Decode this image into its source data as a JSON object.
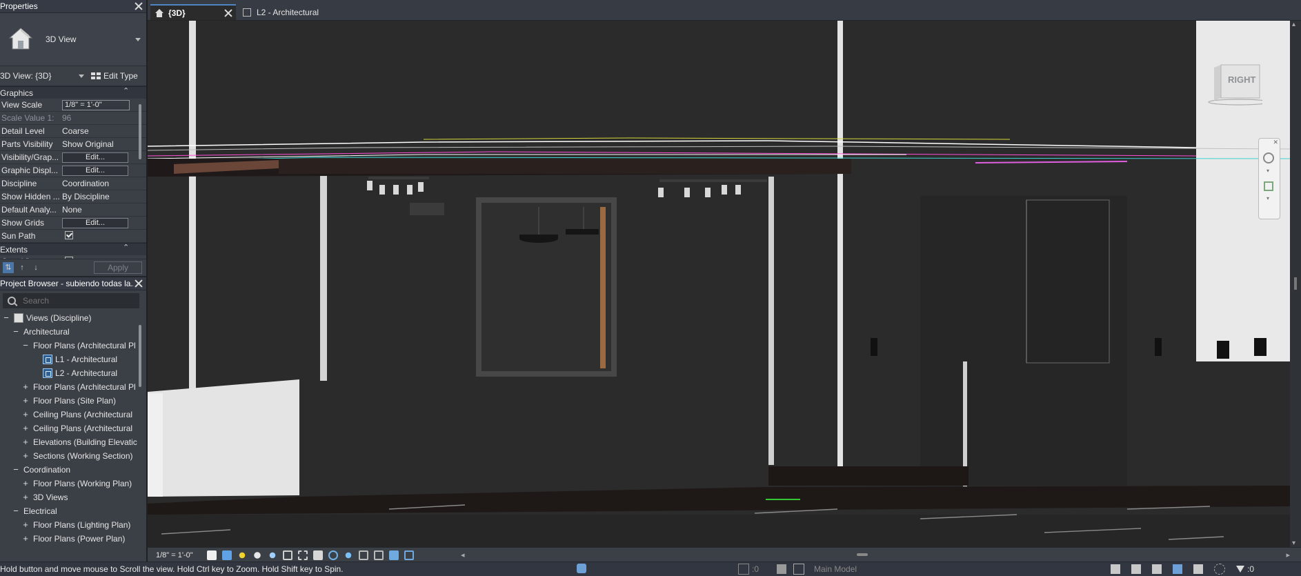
{
  "properties": {
    "title": "Properties",
    "type_name": "3D View",
    "view_selector": "3D View: {3D}",
    "edit_type": "Edit Type",
    "group_graphics": "Graphics",
    "rows": [
      {
        "key": "View Scale",
        "value": "1/8\" = 1'-0\"",
        "kind": "input"
      },
      {
        "key": "Scale Value    1:",
        "value": "96",
        "kind": "dim"
      },
      {
        "key": "Detail Level",
        "value": "Coarse",
        "kind": "text"
      },
      {
        "key": "Parts Visibility",
        "value": "Show Original",
        "kind": "text"
      },
      {
        "key": "Visibility/Grap...",
        "value": "Edit...",
        "kind": "button"
      },
      {
        "key": "Graphic Displ...",
        "value": "Edit...",
        "kind": "button"
      },
      {
        "key": "Discipline",
        "value": "Coordination",
        "kind": "text"
      },
      {
        "key": "Show Hidden ...",
        "value": "By Discipline",
        "kind": "text"
      },
      {
        "key": "Default Analy...",
        "value": "None",
        "kind": "text"
      },
      {
        "key": "Show Grids",
        "value": "Edit...",
        "kind": "button"
      },
      {
        "key": "Sun Path",
        "value": "",
        "kind": "checkbox_on"
      }
    ],
    "group_extents": "Extents",
    "extents_rows": [
      {
        "key": "Crop View",
        "value": "",
        "kind": "checkbox_off"
      }
    ],
    "apply": "Apply"
  },
  "browser": {
    "title": "Project Browser - subiendo todas la...",
    "search_placeholder": "Search",
    "items": [
      {
        "label": "Views (Discipline)",
        "toggle": "−",
        "level": 0,
        "icon": "disc"
      },
      {
        "label": "Architectural",
        "toggle": "−",
        "level": 1
      },
      {
        "label": "Floor Plans (Architectural Pl",
        "toggle": "−",
        "level": 2
      },
      {
        "label": "L1 - Architectural",
        "toggle": "",
        "level": 3,
        "icon": "view"
      },
      {
        "label": "L2 - Architectural",
        "toggle": "",
        "level": 3,
        "icon": "view"
      },
      {
        "label": "Floor Plans (Architectural Pl",
        "toggle": "+",
        "level": 2
      },
      {
        "label": "Floor Plans (Site Plan)",
        "toggle": "+",
        "level": 2
      },
      {
        "label": "Ceiling Plans (Architectural ",
        "toggle": "+",
        "level": 2
      },
      {
        "label": "Ceiling Plans (Architectural ",
        "toggle": "+",
        "level": 2
      },
      {
        "label": "Elevations (Building Elevatic",
        "toggle": "+",
        "level": 2
      },
      {
        "label": "Sections (Working Section)",
        "toggle": "+",
        "level": 2
      },
      {
        "label": "Coordination",
        "toggle": "−",
        "level": 1
      },
      {
        "label": "Floor Plans (Working Plan)",
        "toggle": "+",
        "level": 2
      },
      {
        "label": "3D Views",
        "toggle": "+",
        "level": 2
      },
      {
        "label": "Electrical",
        "toggle": "−",
        "level": 1
      },
      {
        "label": "Floor Plans (Lighting Plan)",
        "toggle": "+",
        "level": 2
      },
      {
        "label": "Floor Plans (Power Plan)",
        "toggle": "+",
        "level": 2
      }
    ]
  },
  "tabs": [
    {
      "label": "{3D}",
      "active": true
    },
    {
      "label": "L2 - Architectural",
      "active": false
    }
  ],
  "viewcube": {
    "face": "RIGHT"
  },
  "viewbar": {
    "scale": "1/8\" = 1'-0\""
  },
  "status": {
    "message": "Hold button and move mouse to Scroll the view. Hold Ctrl key to Zoom. Hold Shift key to Spin.",
    "workset_count": ":0",
    "model": "Main Model",
    "filter_count": ":0"
  },
  "colors": {
    "accent": "#4f85c2",
    "panel": "#3b3f46",
    "canvas": "#2b2b2b"
  }
}
